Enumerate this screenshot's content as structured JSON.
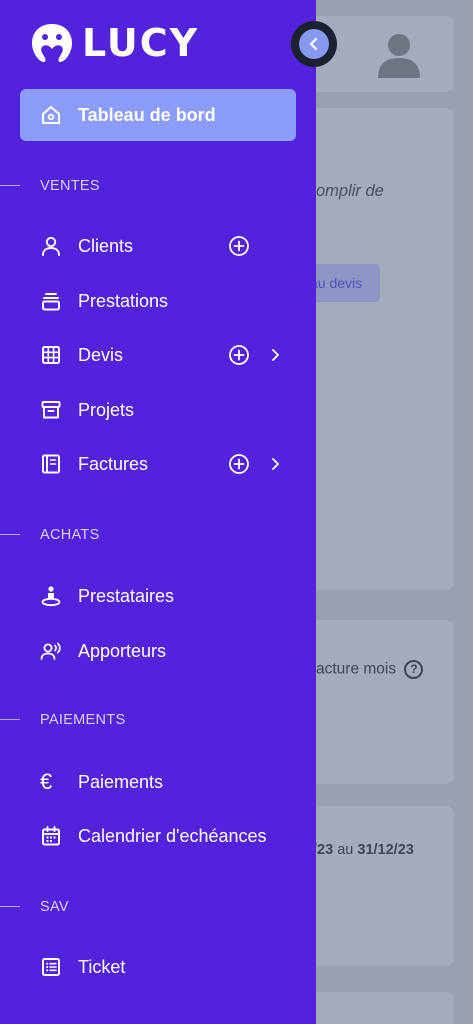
{
  "app": {
    "logo_text": "LUCY"
  },
  "sidebar": {
    "dashboard_label": "Tableau de bord",
    "sections": {
      "ventes": "VENTES",
      "achats": "ACHATS",
      "paiements": "PAIEMENTS",
      "sav": "SAV"
    },
    "items": {
      "clients": "Clients",
      "prestations": "Prestations",
      "devis": "Devis",
      "projets": "Projets",
      "factures": "Factures",
      "prestataires": "Prestataires",
      "apporteurs": "Apporteurs",
      "paiements": "Paiements",
      "calendrier": "Calendrier d'echéances",
      "ticket": "Ticket"
    },
    "euro_symbol": "€"
  },
  "background": {
    "text_complir": "omplir de",
    "button_devis": "au devis",
    "text_facture": "acture mois",
    "help_mark": "?",
    "date_start": "/23",
    "date_sep": "au",
    "date_end": "31/12/23"
  },
  "colors": {
    "sidebar_bg": "#5222dc",
    "dashboard_btn": "#8b9cfa",
    "overlay_bg": "#98a0b2"
  }
}
